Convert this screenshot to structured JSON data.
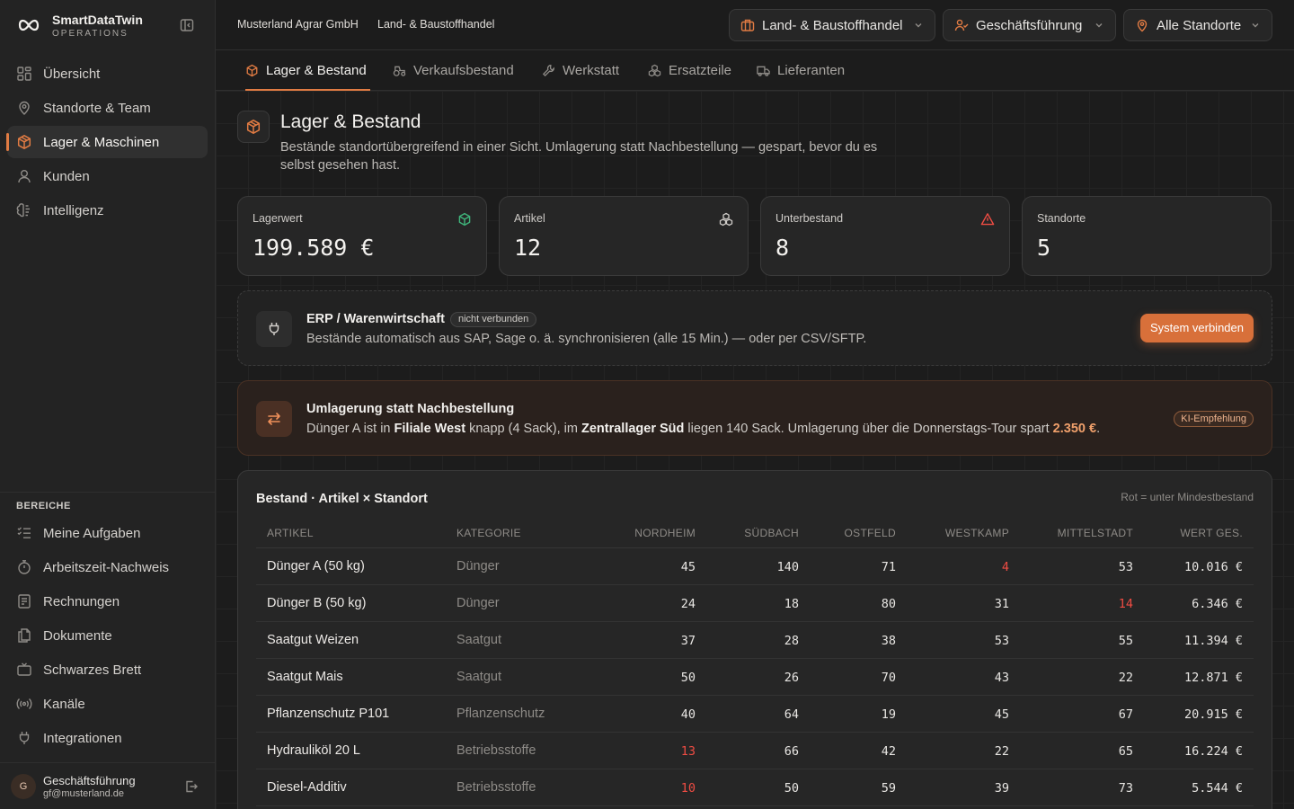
{
  "brand": {
    "name": "SmartDataTwin",
    "subtitle": "OPERATIONS"
  },
  "sidebar": {
    "items": [
      {
        "label": "Übersicht",
        "icon": "grid-icon"
      },
      {
        "label": "Standorte & Team",
        "icon": "map-pin-icon"
      },
      {
        "label": "Lager & Maschinen",
        "icon": "box-icon",
        "active": true
      },
      {
        "label": "Kunden",
        "icon": "user-icon"
      },
      {
        "label": "Intelligenz",
        "icon": "brain-icon"
      }
    ],
    "section_title": "BEREICHE",
    "section_items": [
      {
        "label": "Meine Aufgaben",
        "icon": "tasks-icon"
      },
      {
        "label": "Arbeitszeit-Nachweis",
        "icon": "stopwatch-icon"
      },
      {
        "label": "Rechnungen",
        "icon": "invoice-icon"
      },
      {
        "label": "Dokumente",
        "icon": "documents-icon"
      },
      {
        "label": "Schwarzes Brett",
        "icon": "tv-icon"
      },
      {
        "label": "Kanäle",
        "icon": "radio-icon"
      },
      {
        "label": "Integrationen",
        "icon": "plug-icon"
      }
    ],
    "user": {
      "initial": "G",
      "name": "Geschäftsführung",
      "email": "gf@musterland.de"
    }
  },
  "topbar": {
    "breadcrumb": [
      "Musterland Agrar GmbH",
      "Land- & Baustoffhandel"
    ],
    "dropdowns": [
      {
        "label": "Land- & Baustoffhandel",
        "icon": "briefcase-icon"
      },
      {
        "label": "Geschäftsführung",
        "icon": "users-icon"
      },
      {
        "label": "Alle Standorte",
        "icon": "map-pin-icon"
      }
    ]
  },
  "tabs": [
    {
      "label": "Lager & Bestand",
      "icon": "box-icon",
      "active": true
    },
    {
      "label": "Verkaufsbestand",
      "icon": "tractor-icon"
    },
    {
      "label": "Werkstatt",
      "icon": "wrench-icon"
    },
    {
      "label": "Ersatzteile",
      "icon": "cubes-icon"
    },
    {
      "label": "Lieferanten",
      "icon": "truck-icon"
    }
  ],
  "page": {
    "title": "Lager & Bestand",
    "description": "Bestände standortübergreifend in einer Sicht. Umlagerung statt Nachbestellung — gespart, bevor du es selbst gesehen hast."
  },
  "stats": [
    {
      "label": "Lagerwert",
      "value": "199.589 €",
      "icon": "box-icon",
      "color": "#3fb37a"
    },
    {
      "label": "Artikel",
      "value": "12",
      "icon": "cubes-icon",
      "color": "#cfccc8"
    },
    {
      "label": "Unterbestand",
      "value": "8",
      "icon": "warning-icon",
      "color": "#ef4c43"
    },
    {
      "label": "Standorte",
      "value": "5"
    }
  ],
  "erp": {
    "title": "ERP / Warenwirtschaft",
    "badge": "nicht verbunden",
    "description": "Bestände automatisch aus SAP, Sage o. ä. synchronisieren (alle 15 Min.) — oder per CSV/SFTP.",
    "button": "System verbinden"
  },
  "recommendation": {
    "title": "Umlagerung statt Nachbestellung",
    "text_1": "Dünger A ist in ",
    "branch_low": "Filiale West",
    "text_2": " knapp (4 Sack), im ",
    "branch_high": "Zentrallager Süd",
    "text_3": " liegen 140 Sack. Umlagerung über die Donnerstags-Tour spart ",
    "savings": "2.350 €",
    "text_4": ".",
    "tag": "KI-Empfehlung"
  },
  "table": {
    "title": "Bestand · Artikel × Standort",
    "legend": "Rot = unter Mindestbestand",
    "columns": [
      "ARTIKEL",
      "KATEGORIE",
      "NORDHEIM",
      "SÜDBACH",
      "OSTFELD",
      "WESTKAMP",
      "MITTELSTADT",
      "WERT GES."
    ],
    "rows": [
      {
        "name": "Dünger A (50 kg)",
        "category": "Dünger",
        "values": [
          "45",
          "140",
          "71",
          "4",
          "53"
        ],
        "low": [
          3
        ],
        "total": "10.016 €"
      },
      {
        "name": "Dünger B (50 kg)",
        "category": "Dünger",
        "values": [
          "24",
          "18",
          "80",
          "31",
          "14"
        ],
        "low": [
          4
        ],
        "total": "6.346 €"
      },
      {
        "name": "Saatgut Weizen",
        "category": "Saatgut",
        "values": [
          "37",
          "28",
          "38",
          "53",
          "55"
        ],
        "low": [],
        "total": "11.394 €"
      },
      {
        "name": "Saatgut Mais",
        "category": "Saatgut",
        "values": [
          "50",
          "26",
          "70",
          "43",
          "22"
        ],
        "low": [],
        "total": "12.871 €"
      },
      {
        "name": "Pflanzenschutz P101",
        "category": "Pflanzenschutz",
        "values": [
          "40",
          "64",
          "19",
          "45",
          "67"
        ],
        "low": [],
        "total": "20.915 €"
      },
      {
        "name": "Hydrauliköl 20 L",
        "category": "Betriebsstoffe",
        "values": [
          "13",
          "66",
          "42",
          "22",
          "65"
        ],
        "low": [
          0
        ],
        "total": "16.224 €"
      },
      {
        "name": "Diesel-Additiv",
        "category": "Betriebsstoffe",
        "values": [
          "10",
          "50",
          "59",
          "39",
          "73"
        ],
        "low": [
          0
        ],
        "total": "5.544 €"
      }
    ]
  },
  "colors": {
    "accent": "#e07b43",
    "low_stock": "#ef4c43",
    "ok": "#3fb37a"
  }
}
